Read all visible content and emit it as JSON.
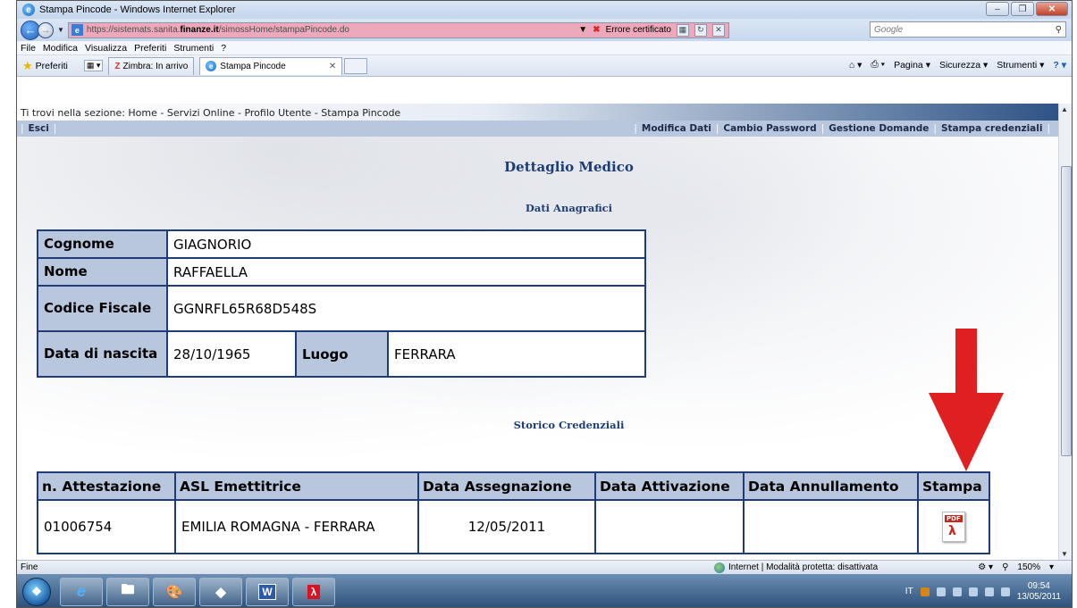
{
  "window": {
    "title": "Stampa Pincode - Windows Internet Explorer"
  },
  "address": {
    "url_prefix": "https://sistemats.sanita.",
    "url_domain": "finanze.it",
    "url_suffix": "/simossHome/stampaPincode.do",
    "cert_error": "Errore certificato"
  },
  "search": {
    "placeholder": "Google"
  },
  "menu": [
    "File",
    "Modifica",
    "Visualizza",
    "Preferiti",
    "Strumenti",
    "?"
  ],
  "favbar": {
    "favorites": "Preferiti",
    "tab1": "Zimbra: In arrivo",
    "tab2": "Stampa Pincode",
    "commands": [
      "Pagina ▾",
      "Sicurezza ▾",
      "Strumenti ▾"
    ]
  },
  "page": {
    "breadcrumb": "Ti trovi nella sezione: Home - Servizi Online - Profilo Utente - Stampa Pincode",
    "nav_left": "Esci",
    "nav_right": [
      "Modifica Dati",
      "Cambio Password",
      "Gestione Domande",
      "Stampa credenziali"
    ],
    "title": "Dettaglio Medico",
    "section_anagrafici": "Dati Anagrafici",
    "anagrafici": {
      "cognome_label": "Cognome",
      "cognome": "GIAGNORIO",
      "nome_label": "Nome",
      "nome": "RAFFAELLA",
      "cf_label": "Codice Fiscale",
      "cf": "GGNRFL65R68D548S",
      "nascita_label": "Data di nascita",
      "nascita": "28/10/1965",
      "luogo_label": "Luogo",
      "luogo": "FERRARA"
    },
    "section_storico": "Storico Credenziali",
    "credenziali": {
      "headers": [
        "n. Attestazione",
        "ASL Emettitrice",
        "Data Assegnazione",
        "Data Attivazione",
        "Data Annullamento",
        "Stampa"
      ],
      "rows": [
        {
          "attestazione": "01006754",
          "asl": "EMILIA ROMAGNA - FERRARA",
          "assegnazione": "12/05/2011",
          "attivazione": "",
          "annullamento": "",
          "stampa_icon": "pdf-icon"
        }
      ]
    }
  },
  "status": {
    "left": "Fine",
    "zone": "Internet | Modalità protetta: disattivata",
    "zoom": "150%"
  },
  "taskbar": {
    "lang": "IT",
    "time": "09:54",
    "date": "13/05/2011"
  },
  "colors": {
    "accent": "#1e3d78",
    "header_bg": "#b8c7dd",
    "arrow": "#e02020"
  }
}
